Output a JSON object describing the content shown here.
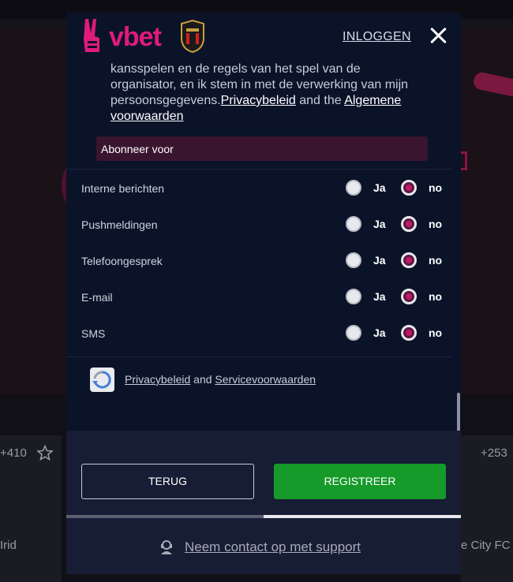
{
  "background": {
    "left_odds": "+410",
    "right_odds": "+253",
    "left_team": "Irid",
    "right_team": "e City FC"
  },
  "modal": {
    "brand": "vbet",
    "login_link": "INLOGGEN",
    "consent": {
      "line1": "kansspelen en de regels van het spel van de",
      "line2": "organisator, en ik stem in met de verwerking van mijn",
      "line3_prefix": "persoonsgegevens.",
      "privacy_link": "Privacybeleid",
      "and_the": " and the ",
      "terms_link_1": "Algemene",
      "terms_link_2": "voorwaarden"
    },
    "subscribe_header": "Abonneer voor",
    "preferences": [
      {
        "label": "Interne berichten",
        "yes": "Ja",
        "no": "no",
        "selected": "no"
      },
      {
        "label": "Pushmeldingen",
        "yes": "Ja",
        "no": "no",
        "selected": "no"
      },
      {
        "label": "Telefoongesprek",
        "yes": "Ja",
        "no": "no",
        "selected": "no"
      },
      {
        "label": "E-mail",
        "yes": "Ja",
        "no": "no",
        "selected": "no"
      },
      {
        "label": "SMS",
        "yes": "Ja",
        "no": "no",
        "selected": "no"
      }
    ],
    "recaptcha": {
      "privacy": "Privacybeleid",
      "and": " and ",
      "terms": "Servicevoorwaarden"
    },
    "buttons": {
      "back": "TERUG",
      "register": "REGISTREER"
    },
    "progress": 0.5,
    "support_link": "Neem contact op met support"
  },
  "colors": {
    "brand": "#e01b7c",
    "register_green": "#169a2a",
    "modal_bg": "#0b1329"
  }
}
